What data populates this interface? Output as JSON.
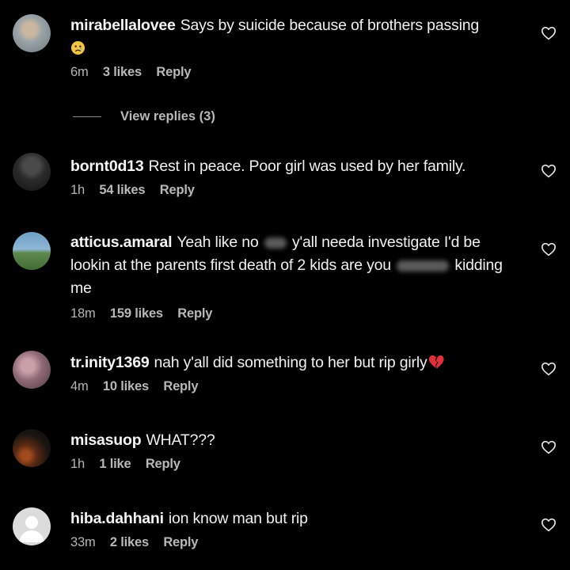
{
  "comments": [
    {
      "username": "mirabellalovee",
      "text": "Says by suicide because of brothers passing",
      "emoji": "sad-face-emoji",
      "time": "6m",
      "likes": "3 likes",
      "reply": "Reply",
      "avatar_colors": [
        "#9aa3a8",
        "#c9b7a1"
      ]
    },
    {
      "username": "bornt0d13",
      "text": "Rest in peace. Poor girl was used by her family.",
      "time": "1h",
      "likes": "54 likes",
      "reply": "Reply",
      "avatar_colors": [
        "#1c1c1c",
        "#3a3a3a"
      ]
    },
    {
      "username": "atticus.amaral",
      "text_a": "Yeah like no",
      "text_b": "y'all needa investigate I'd be lookin at the parents first death of 2 kids are you",
      "text_c": "kidding me",
      "time": "18m",
      "likes": "159 likes",
      "reply": "Reply",
      "avatar_colors": [
        "#5f8fb4",
        "#5e8a4f"
      ]
    },
    {
      "username": "tr.inity1369",
      "text": "nah y'all did something to her but rip girly",
      "emoji": "broken-heart-emoji",
      "time": "4m",
      "likes": "10 likes",
      "reply": "Reply",
      "avatar_colors": [
        "#7a5c68",
        "#b48a93"
      ]
    },
    {
      "username": "misasuop",
      "text": "WHAT???",
      "time": "1h",
      "likes": "1 like",
      "reply": "Reply",
      "avatar_colors": [
        "#1a1512",
        "#7a3a1a"
      ]
    },
    {
      "username": "hiba.dahhani",
      "text": "ion know man but rip",
      "time": "33m",
      "likes": "2 likes",
      "reply": "Reply",
      "avatar_colors": [
        "#d9d9d9",
        "#ffffff"
      ]
    }
  ],
  "view_replies": "View replies (3)",
  "icons": {
    "like": "heart-outline-icon"
  },
  "colors": {
    "background": "#000000",
    "text": "#f0f0f0",
    "meta": "#b5b5b5",
    "broken_heart": "#e0303a"
  }
}
